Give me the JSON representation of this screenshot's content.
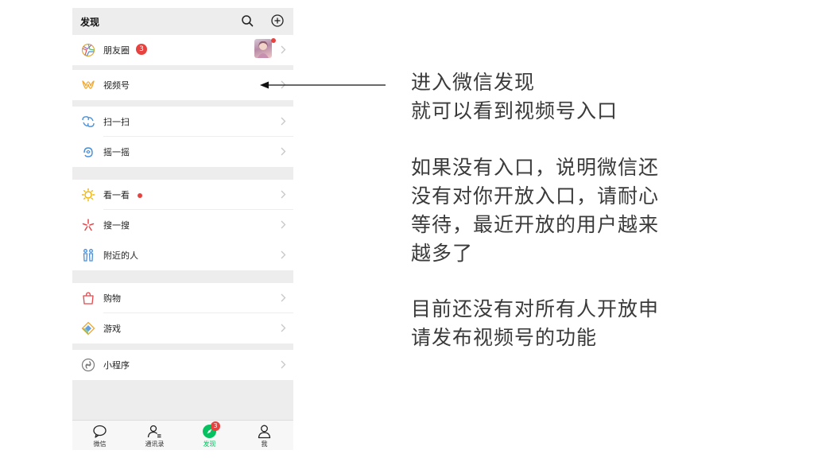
{
  "header": {
    "title": "发现",
    "search_icon": "search-icon",
    "add_icon": "add-circle-icon"
  },
  "menu": {
    "moments": {
      "label": "朋友圈",
      "badge": "3",
      "icon": "moments-icon"
    },
    "channels": {
      "label": "视频号",
      "icon": "channels-icon"
    },
    "scan": {
      "label": "扫一扫",
      "icon": "scan-icon"
    },
    "shake": {
      "label": "摇一摇",
      "icon": "shake-icon"
    },
    "top_stories": {
      "label": "看一看",
      "icon": "top-stories-icon"
    },
    "search": {
      "label": "搜一搜",
      "icon": "search-feature-icon"
    },
    "nearby": {
      "label": "附近的人",
      "icon": "people-nearby-icon"
    },
    "shopping": {
      "label": "购物",
      "icon": "shopping-bag-icon"
    },
    "games": {
      "label": "游戏",
      "icon": "games-icon"
    },
    "mini_programs": {
      "label": "小程序",
      "icon": "mini-program-icon"
    }
  },
  "tabbar": [
    {
      "label": "微信",
      "icon": "chat-bubble-icon"
    },
    {
      "label": "通讯录",
      "icon": "contacts-icon"
    },
    {
      "label": "发现",
      "icon": "discover-compass-icon",
      "badge": "3"
    },
    {
      "label": "我",
      "icon": "me-icon"
    }
  ],
  "notes": {
    "line1": "进入微信发现",
    "line2": "就可以看到视频号入口",
    "line3": "如果没有入口，说明微信还",
    "line4": "没有对你开放入口，请耐心",
    "line5": "等待，最近开放的用户越来",
    "line6": "越多了",
    "line7": "目前还没有对所有人开放申",
    "line8": "请发布视频号的功能"
  },
  "colors": {
    "accent_green": "#07c160",
    "badge_red": "#e64340",
    "background": "#ededed"
  }
}
